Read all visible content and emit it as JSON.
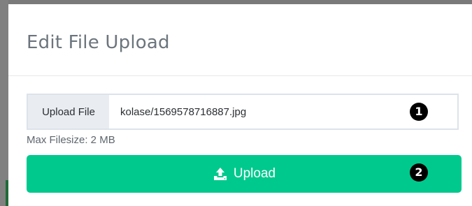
{
  "modal": {
    "title": "Edit File Upload"
  },
  "upload_field": {
    "label": "Upload File",
    "value": "kolase/1569578716887.jpg",
    "max_filesize": "Max Filesize: 2 MB"
  },
  "upload_button": {
    "label": "Upload",
    "icon": "upload-icon",
    "color": "#00c98d"
  },
  "annotations": [
    {
      "marker": "1",
      "target": "upload-field"
    },
    {
      "marker": "2",
      "target": "upload-button"
    }
  ]
}
